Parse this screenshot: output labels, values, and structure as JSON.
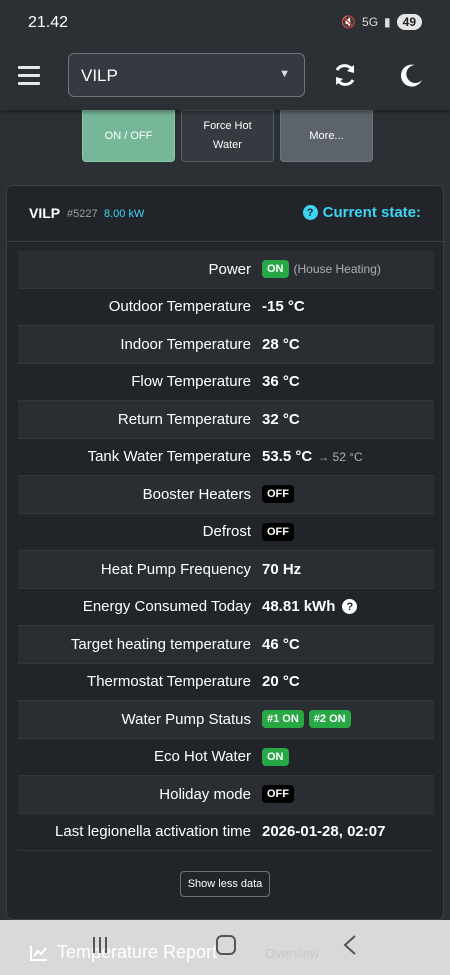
{
  "status_bar": {
    "time": "21.42",
    "network": "5G",
    "battery": "49"
  },
  "navbar": {
    "device_selected": "VILP",
    "icons": [
      "hamburger-menu-icon",
      "refresh-icon",
      "moon-icon"
    ]
  },
  "quick_buttons": {
    "on_off": "ON / OFF",
    "force_hot_line1": "Force Hot",
    "force_hot_line2": "Water",
    "more": "More..."
  },
  "card": {
    "title": "VILP",
    "device_id": "#5227",
    "power_kw": "8.00 kW",
    "current_state_label": "Current state:"
  },
  "rows": {
    "power": {
      "label": "Power",
      "badge": "ON",
      "note": "(House Heating)"
    },
    "outdoor": {
      "label": "Outdoor Temperature",
      "value": "-15 °C"
    },
    "indoor": {
      "label": "Indoor Temperature",
      "value": "28 °C"
    },
    "flow": {
      "label": "Flow Temperature",
      "value": "36 °C"
    },
    "return": {
      "label": "Return Temperature",
      "value": "32 °C"
    },
    "tank": {
      "label": "Tank Water Temperature",
      "value": "53.5 °C",
      "target": "→ 52 °C"
    },
    "booster": {
      "label": "Booster Heaters",
      "badge": "OFF"
    },
    "defrost": {
      "label": "Defrost",
      "badge": "OFF"
    },
    "frequency": {
      "label": "Heat Pump Frequency",
      "value": "70 Hz"
    },
    "energy": {
      "label": "Energy Consumed Today",
      "value": "48.81 kWh"
    },
    "target_heating": {
      "label": "Target heating temperature",
      "value": "46 °C"
    },
    "thermostat": {
      "label": "Thermostat Temperature",
      "value": "20 °C"
    },
    "water_pump": {
      "label": "Water Pump Status",
      "badge1": "#1 ON",
      "badge2": "#2 ON"
    },
    "eco_hot_water": {
      "label": "Eco Hot Water",
      "badge": "ON"
    },
    "holiday": {
      "label": "Holiday mode",
      "badge": "OFF"
    },
    "legionella": {
      "label": "Last legionella activation time",
      "value": "2026-01-28, 02:07"
    }
  },
  "show_less_label": "Show less data",
  "bottom_bar": {
    "temperature_report": "Temperature Report",
    "ghost_text": "Overview"
  },
  "colors": {
    "on": "#28a745",
    "off": "#000000",
    "accent": "#3dd5f3",
    "on_off_button": "#75b798"
  }
}
